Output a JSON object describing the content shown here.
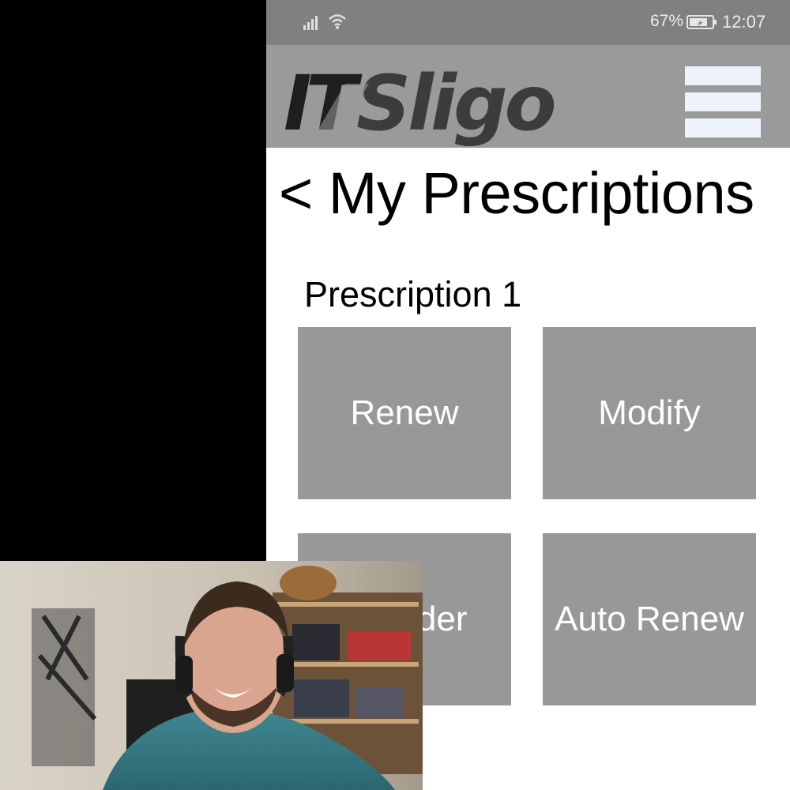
{
  "status_bar": {
    "battery_percent": "67%",
    "time": "12:07",
    "icons": [
      "signal-icon",
      "wifi-icon",
      "battery-icon"
    ]
  },
  "header": {
    "logo_text": "ITSligo",
    "menu_icon": "hamburger-menu-icon"
  },
  "page": {
    "title": "< My Prescriptions",
    "section_label": "Prescription 1"
  },
  "actions": [
    {
      "label": "Renew"
    },
    {
      "label": "Modify"
    },
    {
      "label": "Reorder"
    },
    {
      "label": "Auto Renew"
    }
  ],
  "colors": {
    "status_bar": "#808080",
    "header": "#9a9a9a",
    "tile": "#989898",
    "menu_bars": "#eef2fb"
  }
}
